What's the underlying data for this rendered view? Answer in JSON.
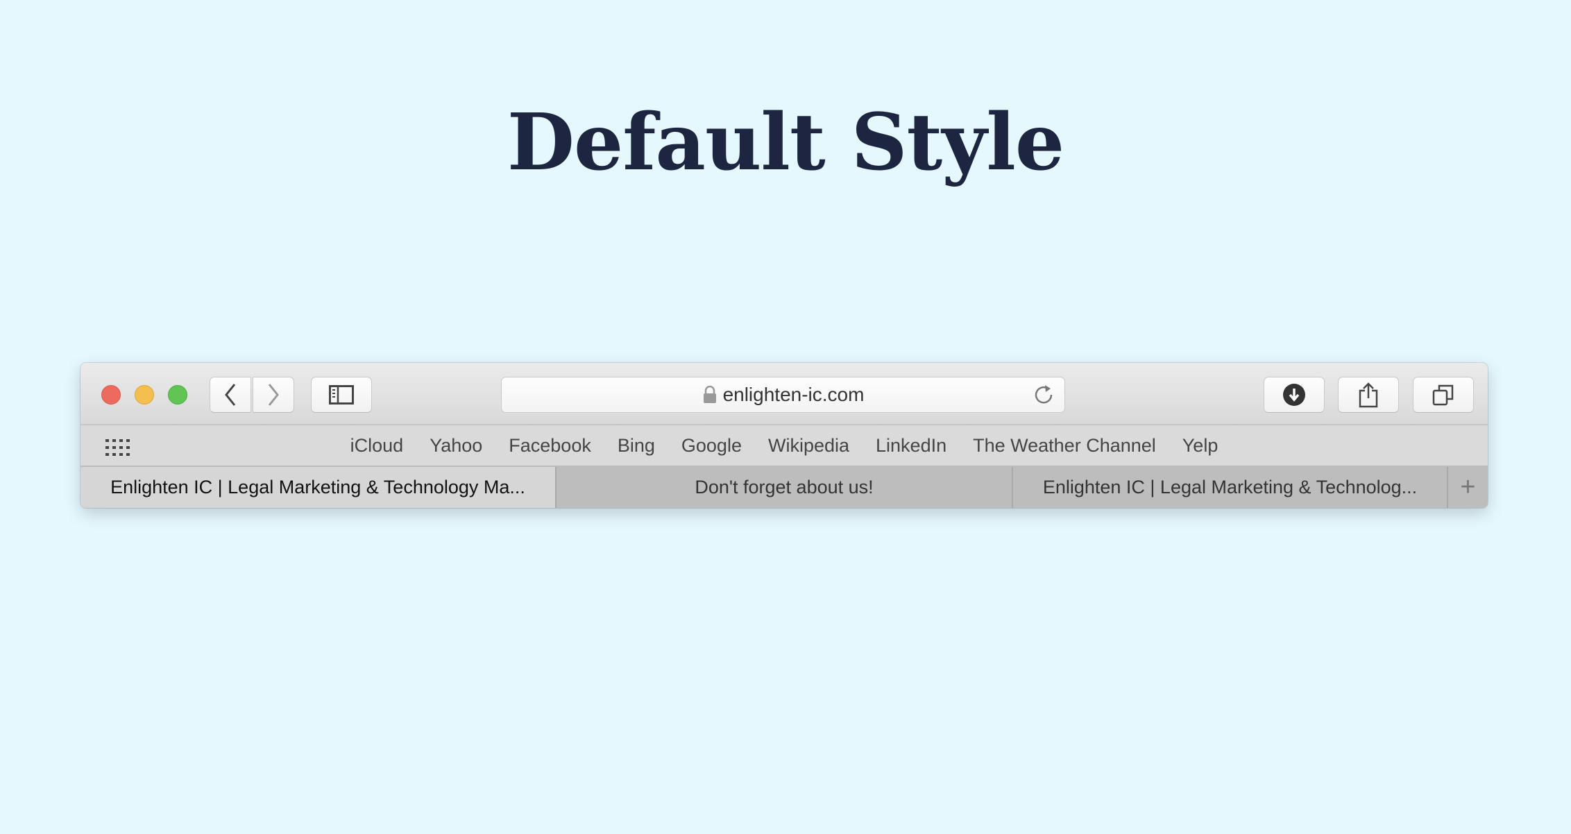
{
  "heading": "Default Style",
  "browser": {
    "address": "enlighten-ic.com",
    "traffic_lights": {
      "close": "#ed6a5e",
      "minimize": "#f5bf4f",
      "zoom": "#61c554"
    },
    "bookmarks": [
      "iCloud",
      "Yahoo",
      "Facebook",
      "Bing",
      "Google",
      "Wikipedia",
      "LinkedIn",
      "The Weather Channel",
      "Yelp"
    ],
    "tabs": [
      {
        "title": "Enlighten IC | Legal Marketing & Technology Ma...",
        "active": true
      },
      {
        "title": "Don't forget about us!",
        "active": false
      },
      {
        "title": "Enlighten IC | Legal Marketing & Technolog...",
        "active": false
      }
    ],
    "new_tab": "+"
  }
}
